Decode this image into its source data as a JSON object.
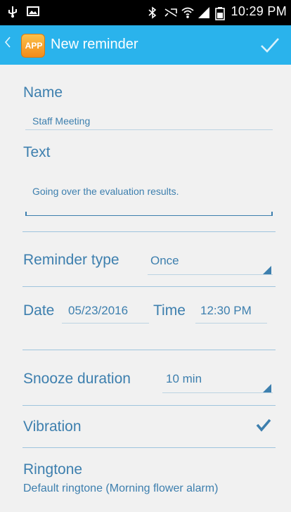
{
  "status_bar": {
    "time": "10:29 PM",
    "icons": [
      "usb-icon",
      "image-icon",
      "bluetooth-icon",
      "mute-icon",
      "wifi-icon",
      "signal-icon",
      "battery-icon"
    ]
  },
  "action_bar": {
    "app_icon_text": "APP",
    "title": "New reminder",
    "icons": [
      "back-chevron-icon",
      "checkmark-icon"
    ]
  },
  "form": {
    "name_label": "Name",
    "name_value": "Staff Meeting",
    "text_label": "Text",
    "text_value": "Going over the evaluation results.",
    "reminder_type_label": "Reminder type",
    "reminder_type_value": "Once",
    "date_label": "Date",
    "date_value": "05/23/2016",
    "time_label": "Time",
    "time_value": "12:30 PM",
    "snooze_label": "Snooze duration",
    "snooze_value": "10 min",
    "vibration_label": "Vibration",
    "vibration_checked": true,
    "ringtone_label": "Ringtone",
    "ringtone_value": "Default ringtone (Morning flower alarm)"
  },
  "colors": {
    "action_bar": "#2ab3ec",
    "accent_text": "#3d7fae",
    "background": "#f1f1f1"
  }
}
